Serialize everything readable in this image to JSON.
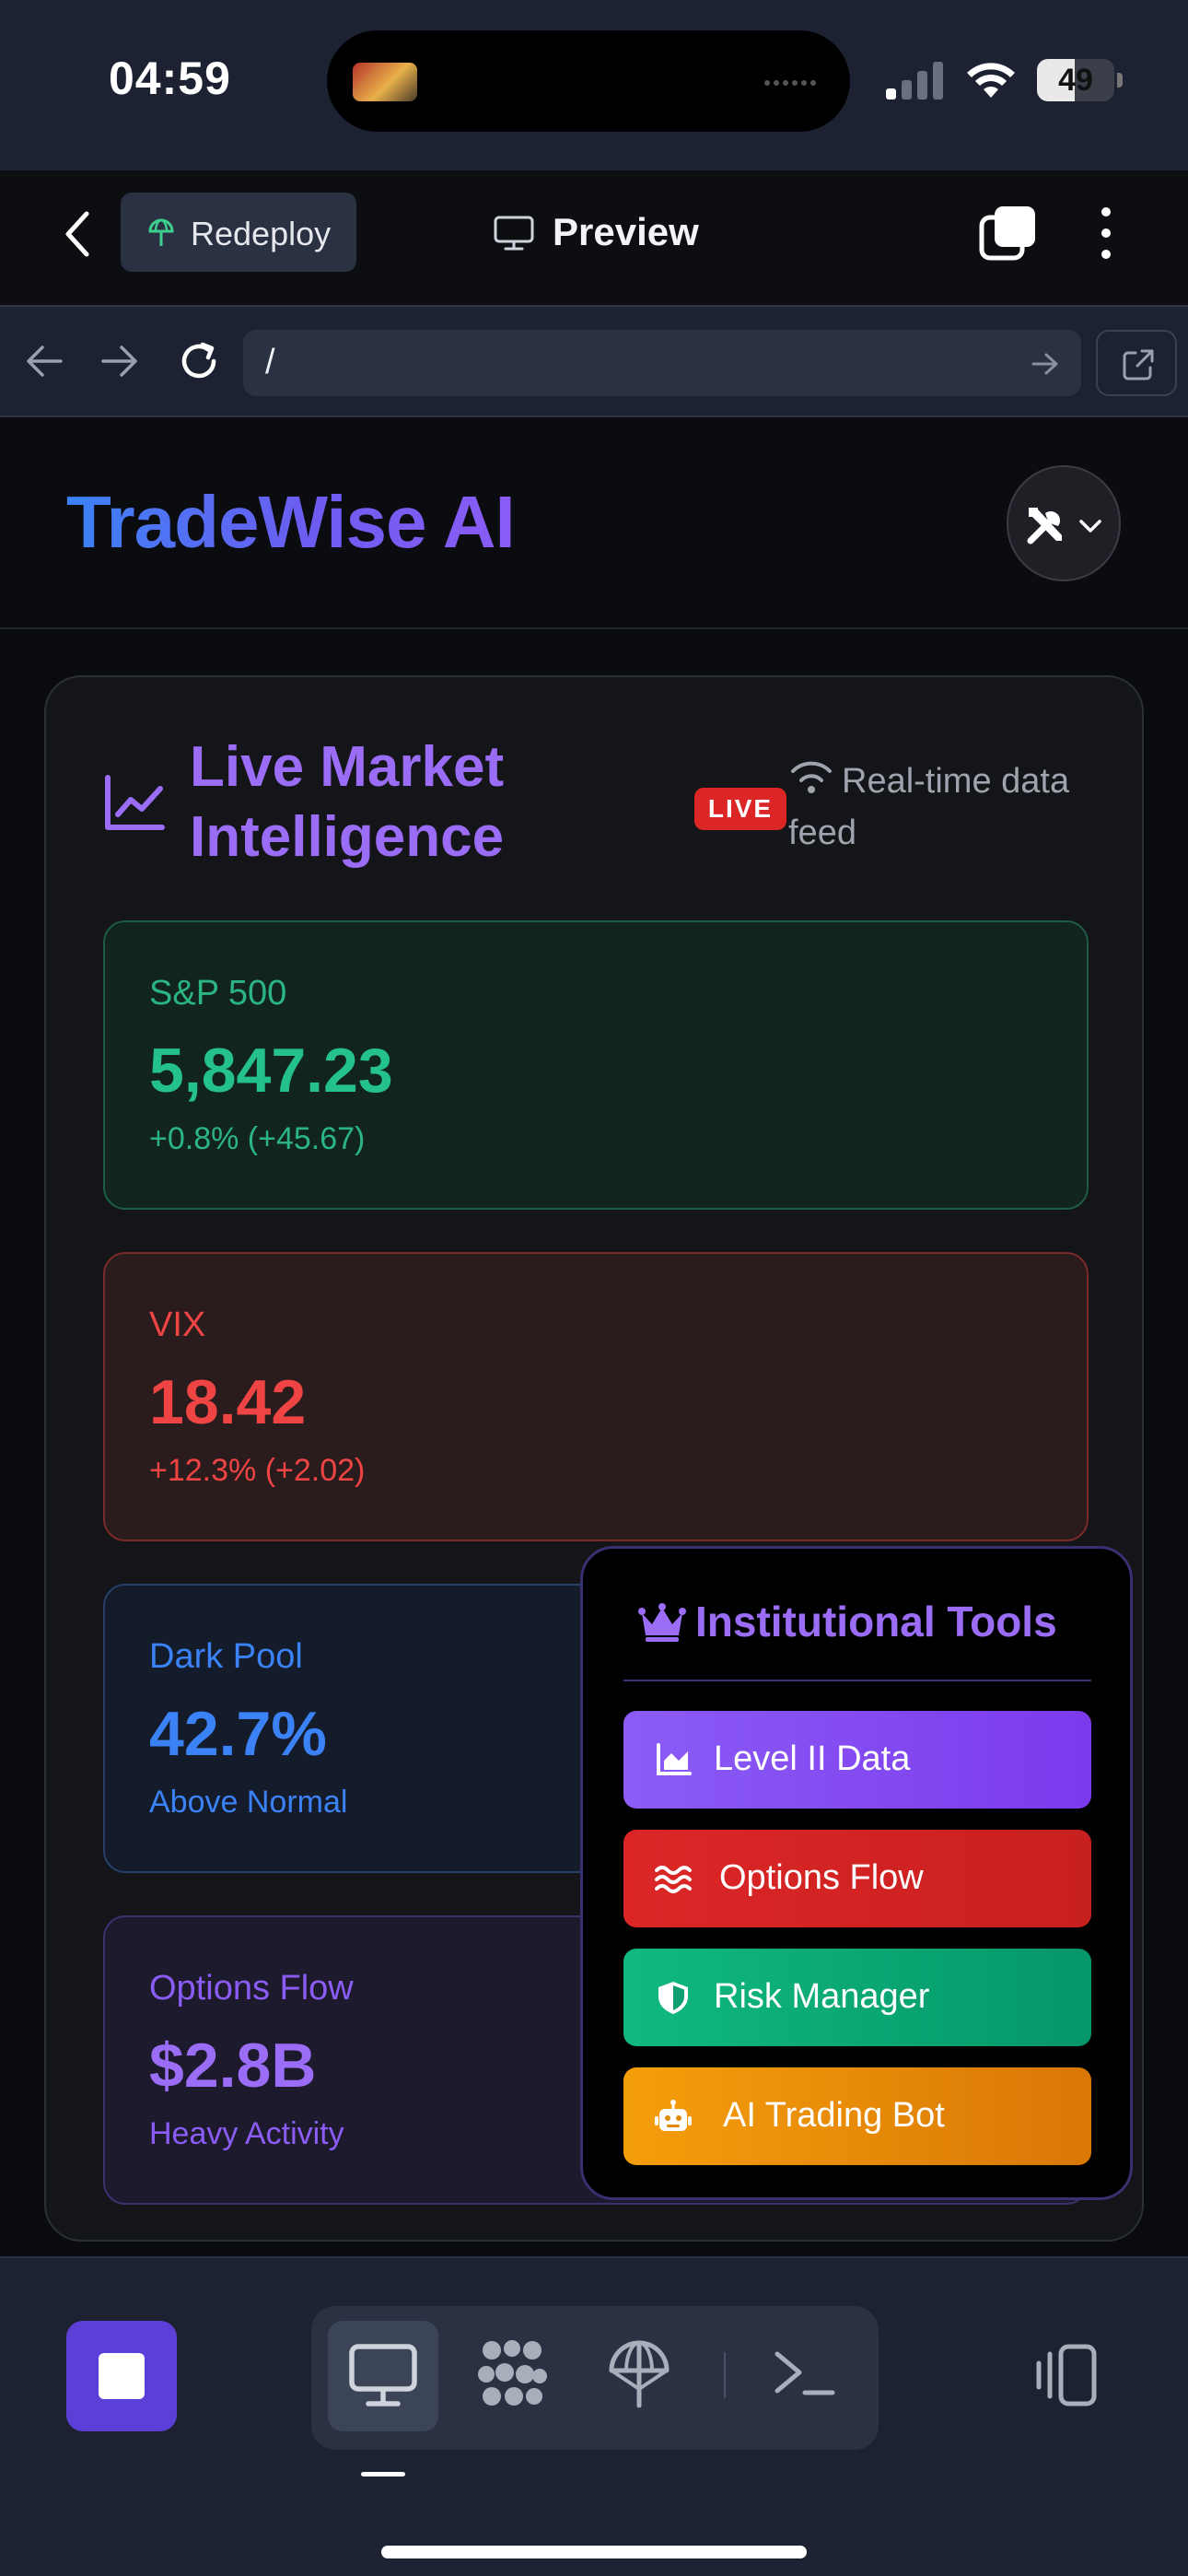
{
  "status_bar": {
    "time": "04:59",
    "battery_percent": "49",
    "battery_level": 0.49,
    "icons": [
      "signal-icon",
      "wifi-icon",
      "battery-icon"
    ]
  },
  "app_header": {
    "redeploy_label": "Redeploy",
    "preview_title": "Preview",
    "icons": [
      "back-chevron-icon",
      "redeploy-icon",
      "monitor-icon",
      "tabs-icon",
      "more-vertical-icon"
    ]
  },
  "browser": {
    "url": "/",
    "icons": [
      "arrow-left-icon",
      "arrow-right-icon",
      "reload-icon",
      "go-arrow-icon",
      "external-link-icon"
    ]
  },
  "site": {
    "title": "TradeWise AI",
    "tools_icon": "tools-icon"
  },
  "market": {
    "title": "Live Market Intelligence",
    "live_badge": "LIVE",
    "feed_text": "Real-time data feed",
    "cards": [
      {
        "label": "S&P 500",
        "value": "5,847.23",
        "change": "+0.8% (+45.67)"
      },
      {
        "label": "VIX",
        "value": "18.42",
        "change": "+12.3% (+2.02)"
      },
      {
        "label": "Dark Pool",
        "value": "42.7%",
        "note": "Above Normal"
      },
      {
        "label": "Options Flow",
        "value": "$2.8B",
        "note": "Heavy Activity"
      }
    ]
  },
  "institutional_menu": {
    "title": "Institutional Tools",
    "items": [
      {
        "label": "Level II Data",
        "icon": "chart-area-icon"
      },
      {
        "label": "Options Flow",
        "icon": "water-icon"
      },
      {
        "label": "Risk Manager",
        "icon": "shield-icon"
      },
      {
        "label": "AI Trading Bot",
        "icon": "robot-icon"
      }
    ]
  },
  "colors": {
    "accent_purple": "#9b6cf5",
    "positive": "#24c28a",
    "negative": "#ef4444",
    "info_blue": "#3b82f6",
    "warning_orange": "#f59e0b"
  },
  "bottom_bar": {
    "icons": [
      "stop-icon",
      "monitor-icon",
      "packages-icon",
      "deploy-icon",
      "terminal-icon",
      "layout-toggle-icon"
    ]
  }
}
